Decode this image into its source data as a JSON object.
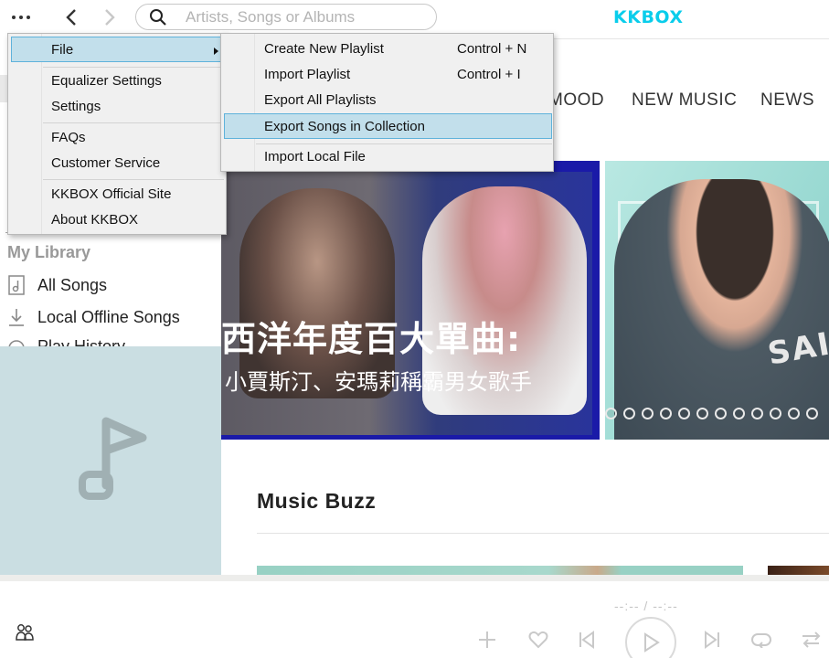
{
  "app": {
    "logo": "KKBOX",
    "search_placeholder": "Artists, Songs or Albums",
    "brand_color": "#09cdeb"
  },
  "nav": {
    "tabs": [
      "MOOD",
      "NEW MUSIC",
      "NEWS"
    ]
  },
  "sidebar": {
    "library_title": "My Library",
    "items": [
      {
        "label": "All Songs",
        "icon": "music-file-icon"
      },
      {
        "label": "Local Offline Songs",
        "icon": "download-icon"
      },
      {
        "label": "Play History",
        "icon": "history-icon"
      }
    ]
  },
  "banners": {
    "primary": {
      "headline": "西洋年度百大單曲:",
      "subline": "小賈斯汀、安瑪莉稱霸男女歌手"
    },
    "secondary": {
      "shirt_text": "SAI"
    },
    "page_dots": 12
  },
  "sections": {
    "music_buzz_title": "Music Buzz"
  },
  "player": {
    "time_display": "--:--  /  --:--",
    "controls": [
      "add-icon",
      "heart-icon",
      "previous-icon",
      "play-icon",
      "next-icon",
      "repeat-icon",
      "shuffle-icon"
    ]
  },
  "menu": {
    "main": {
      "file": "File",
      "equalizer": "Equalizer Settings",
      "settings": "Settings",
      "faqs": "FAQs",
      "customer_service": "Customer Service",
      "official_site": "KKBOX Official Site",
      "about": "About KKBOX"
    },
    "file_submenu": {
      "create_playlist": "Create New Playlist",
      "create_shortcut": "Control + N",
      "import_playlist": "Import Playlist",
      "import_shortcut": "Control + I",
      "export_all": "Export All Playlists",
      "export_songs": "Export Songs in Collection",
      "import_local": "Import Local File"
    }
  }
}
